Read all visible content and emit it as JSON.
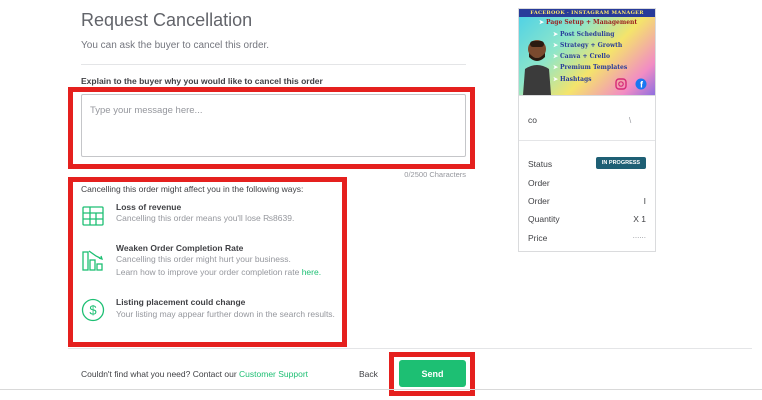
{
  "page": {
    "title": "Request Cancellation",
    "subtitle": "You can ask the buyer to cancel this order.",
    "explain_label": "Explain to the buyer why you would like to cancel this order",
    "message_placeholder": "Type your message here...",
    "char_counter": "0/2500 Characters"
  },
  "warnings": {
    "heading": "Cancelling this order might affect you in the following ways:",
    "items": [
      {
        "icon": "revenue-grid-icon",
        "title": "Loss of revenue",
        "text": "Cancelling this order means you'll lose ₨8639."
      },
      {
        "icon": "chart-down-icon",
        "title": "Weaken Order Completion Rate",
        "text": "Cancelling this order might hurt your business.",
        "text2": "Learn how to improve your order completion rate ",
        "link": "here."
      },
      {
        "icon": "dollar-circle-icon",
        "title": "Listing placement could change",
        "text": "Your listing may appear further down in the search results."
      }
    ]
  },
  "footer": {
    "help_text": "Couldn't find what you need? Contact our ",
    "help_link": "Customer Support",
    "back_label": "Back",
    "send_label": "Send"
  },
  "sidebar": {
    "banner": {
      "header": "FACEBOOK · INSTAGRAM MANAGER",
      "lines": [
        "Page Setup + Management",
        "Post Scheduling",
        "Strategy + Growth",
        "Canva + Crello",
        "Premium Templates",
        "Hashtags"
      ]
    },
    "order_id": "co",
    "rows": [
      {
        "label": "Status",
        "value": ""
      },
      {
        "label": "Order",
        "value": ""
      },
      {
        "label": "Order",
        "value": "I"
      },
      {
        "label": "Quantity",
        "value": "X 1"
      },
      {
        "label": "Price",
        "value": "......"
      }
    ],
    "status_badge": "IN PROGRESS"
  },
  "colors": {
    "accent": "#1dbf73",
    "annotation_red": "#e5201e",
    "badge": "#1e5f74"
  }
}
